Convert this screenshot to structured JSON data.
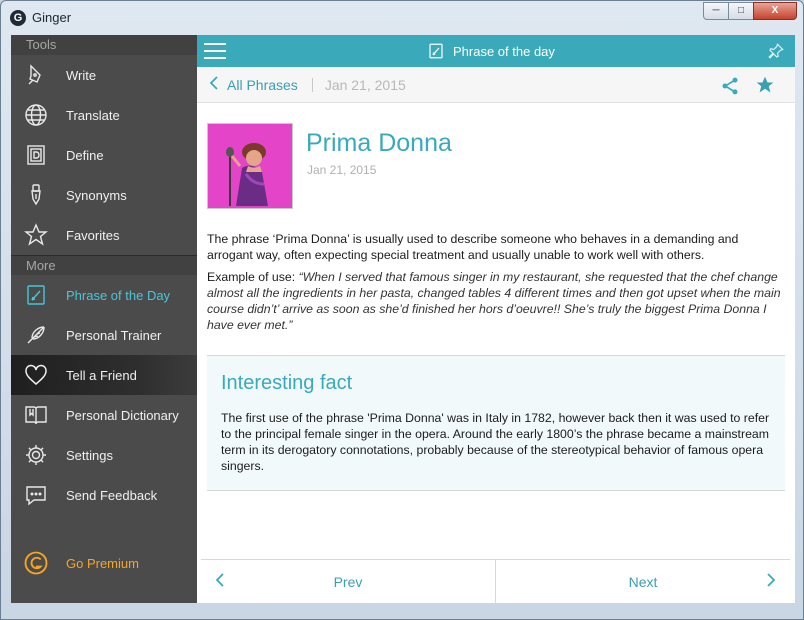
{
  "window": {
    "title": "Ginger",
    "logo_letter": "G"
  },
  "window_controls": {
    "minimize": "─",
    "maximize": "□",
    "close": "X"
  },
  "sidebar": {
    "tools_label": "Tools",
    "more_label": "More",
    "tools": [
      {
        "label": "Write",
        "icon": "pen-icon"
      },
      {
        "label": "Translate",
        "icon": "globe-icon"
      },
      {
        "label": "Define",
        "icon": "dictionary-icon"
      },
      {
        "label": "Synonyms",
        "icon": "nib-icon"
      },
      {
        "label": "Favorites",
        "icon": "star-icon"
      }
    ],
    "more": [
      {
        "label": "Phrase of the Day",
        "icon": "notebook-pen-icon",
        "active": true
      },
      {
        "label": "Personal Trainer",
        "icon": "feather-icon"
      },
      {
        "label": "Tell a Friend",
        "icon": "heart-icon"
      },
      {
        "label": "Personal Dictionary",
        "icon": "open-book-icon"
      },
      {
        "label": "Settings",
        "icon": "gear-icon"
      },
      {
        "label": "Send Feedback",
        "icon": "chat-icon"
      }
    ],
    "premium_label": "Go Premium"
  },
  "topbar": {
    "title": "Phrase of the day"
  },
  "subbar": {
    "back_label": "All Phrases",
    "date": "Jan 21, 2015"
  },
  "phrase": {
    "title": "Prima Donna",
    "date": "Jan 21, 2015",
    "description": "The phrase ‘Prima Donna’ is usually used to describe someone who behaves in a demanding and arrogant way, often expecting special treatment and usually unable to work well with others.",
    "example_label": "Example of use: ",
    "example_quote": "“When I served that famous singer in my restaurant, she requested that the chef change almost all the ingredients in her pasta, changed tables 4 different times and then got upset when the main course didn’t’ arrive as soon as she’d finished her hors d’oeuvre!! She’s truly the biggest Prima Donna I have ever met.”"
  },
  "fact": {
    "title": "Interesting fact",
    "body": "The first use of the phrase 'Prima Donna' was in Italy in 1782, however back then it was used to refer to the principal female singer in the opera. Around the early 1800’s the phrase became a mainstream term in its derogatory connotations, probably because of the stereotypical behavior of famous opera singers."
  },
  "pager": {
    "prev": "Prev",
    "next": "Next"
  },
  "colors": {
    "accent": "#3aaabb",
    "sidebar_bg": "#4b4b4b",
    "premium": "#f5a623",
    "thumb_bg": "#e444c8"
  }
}
